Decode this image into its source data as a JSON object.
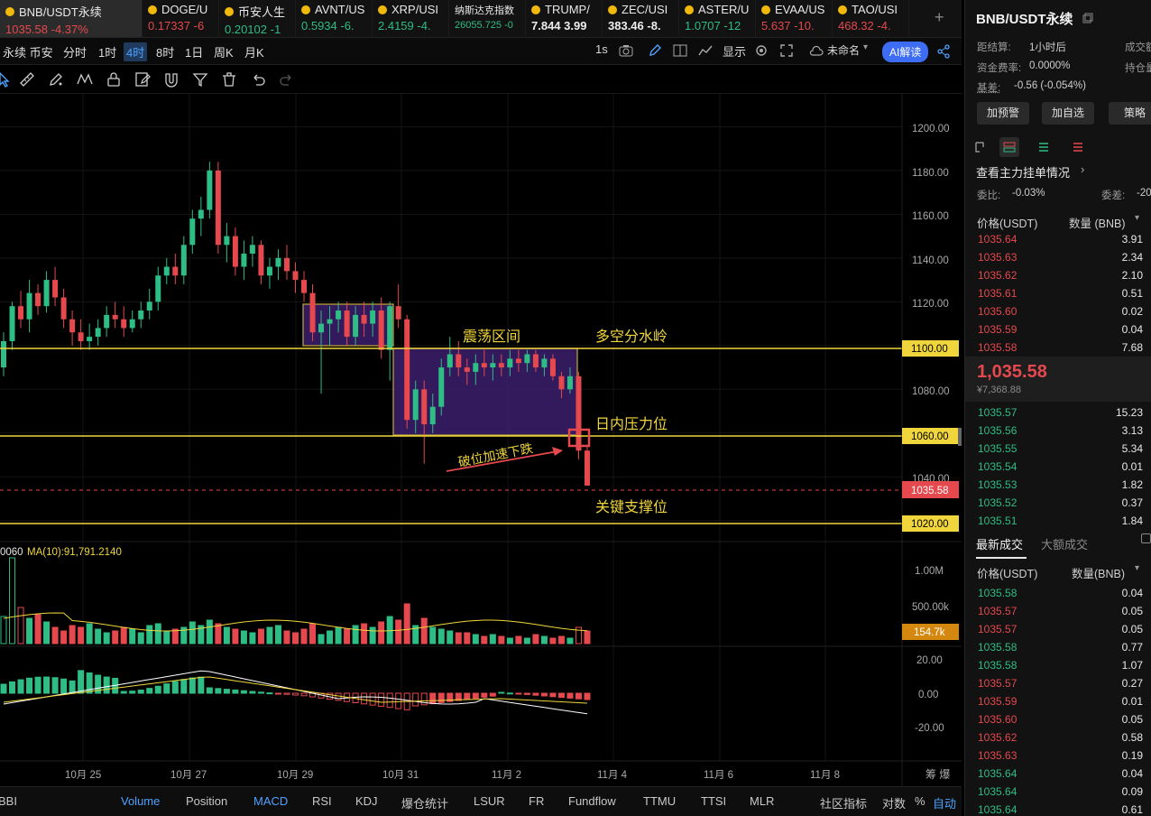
{
  "tickers": [
    {
      "name": "BNB/USDT永续",
      "price": "1035.58",
      "change": "-4.37%",
      "dir": "red",
      "active": true
    },
    {
      "name": "DOGE/U",
      "price": "0.17337",
      "change": "-6",
      "dir": "red"
    },
    {
      "name": "币安人生",
      "price": "0.20102",
      "change": "-1",
      "dir": "green"
    },
    {
      "name": "AVNT/US",
      "price": "0.5934",
      "change": "-6.",
      "dir": "green"
    },
    {
      "name": "XRP/USI",
      "price": "2.4159",
      "change": "-4.",
      "dir": "green"
    },
    {
      "name": "纳斯达克指数",
      "price": "26055.725",
      "change": "-0",
      "dir": "green",
      "small": true
    },
    {
      "name": "TRUMP/",
      "price": "7.844",
      "change": "3.99",
      "dir": "white"
    },
    {
      "name": "ZEC/USI",
      "price": "383.46",
      "change": "-8.",
      "dir": "white"
    },
    {
      "name": "ASTER/U",
      "price": "1.0707",
      "change": "-12",
      "dir": "green"
    },
    {
      "name": "EVAA/US",
      "price": "5.637",
      "change": "-10.",
      "dir": "red"
    },
    {
      "name": "TAO/USI",
      "price": "468.32",
      "change": "-4.",
      "dir": "red"
    }
  ],
  "toolbar": {
    "symbol_label": "永续 币安",
    "intervals": [
      "分时",
      "1时",
      "4时",
      "8时",
      "1日",
      "周K",
      "月K"
    ],
    "selected_interval": "4时",
    "one_sec": "1s",
    "display": "显示",
    "layout_name": "未命名",
    "ai_label": "AI解读"
  },
  "chart": {
    "y_ticks": [
      "1200.00",
      "1180.00",
      "1160.00",
      "1140.00",
      "1120.00",
      "1080.00",
      "1040.00"
    ],
    "x_ticks": [
      "10月 25",
      "10月 27",
      "10月 29",
      "10月 31",
      "11月 2",
      "11月 4",
      "11月 6",
      "11月 8"
    ],
    "levels": {
      "l1100": "1100.00",
      "l1060": "1060.00",
      "l1020": "1020.00",
      "last": "1035.58"
    },
    "annotations": {
      "range": "震荡区间",
      "divide": "多空分水岭",
      "resist": "日内压力位",
      "support": "关键支撑位",
      "breakdown": "破位加速下跌"
    },
    "volume": {
      "ma_label": "MA(10):91,791.2140",
      "left_label": "0060",
      "ticks": [
        "1.00M",
        "500.00k"
      ],
      "current": "154.7k"
    },
    "macd_ticks": [
      "20.00",
      "0.00",
      "-20.00"
    ],
    "right_corner": "筹 爆"
  },
  "chart_data": {
    "type": "candlestick",
    "interval": "4时",
    "series_ohlc": [
      [
        1090,
        1106,
        1086,
        1102
      ],
      [
        1102,
        1120,
        1098,
        1118
      ],
      [
        1118,
        1125,
        1108,
        1112
      ],
      [
        1112,
        1130,
        1106,
        1124
      ],
      [
        1124,
        1128,
        1114,
        1118
      ],
      [
        1118,
        1134,
        1115,
        1130
      ],
      [
        1130,
        1136,
        1118,
        1122
      ],
      [
        1122,
        1126,
        1108,
        1112
      ],
      [
        1112,
        1116,
        1100,
        1106
      ],
      [
        1106,
        1112,
        1098,
        1102
      ],
      [
        1102,
        1110,
        1098,
        1104
      ],
      [
        1104,
        1112,
        1100,
        1108
      ],
      [
        1108,
        1118,
        1104,
        1114
      ],
      [
        1114,
        1120,
        1108,
        1112
      ],
      [
        1112,
        1118,
        1104,
        1108
      ],
      [
        1108,
        1116,
        1106,
        1112
      ],
      [
        1112,
        1120,
        1108,
        1116
      ],
      [
        1116,
        1126,
        1112,
        1120
      ],
      [
        1120,
        1136,
        1116,
        1132
      ],
      [
        1132,
        1140,
        1128,
        1136
      ],
      [
        1136,
        1142,
        1128,
        1132
      ],
      [
        1132,
        1150,
        1128,
        1146
      ],
      [
        1146,
        1162,
        1142,
        1158
      ],
      [
        1158,
        1168,
        1150,
        1162
      ],
      [
        1162,
        1184,
        1158,
        1180
      ],
      [
        1180,
        1184,
        1142,
        1146
      ],
      [
        1146,
        1156,
        1138,
        1150
      ],
      [
        1150,
        1154,
        1132,
        1136
      ],
      [
        1136,
        1148,
        1130,
        1142
      ],
      [
        1142,
        1150,
        1136,
        1146
      ],
      [
        1146,
        1148,
        1128,
        1132
      ],
      [
        1132,
        1140,
        1126,
        1136
      ],
      [
        1136,
        1144,
        1130,
        1140
      ],
      [
        1140,
        1146,
        1130,
        1134
      ],
      [
        1134,
        1138,
        1124,
        1130
      ],
      [
        1130,
        1134,
        1120,
        1124
      ],
      [
        1124,
        1128,
        1102,
        1106
      ],
      [
        1106,
        1116,
        1078,
        1110
      ],
      [
        1110,
        1118,
        1100,
        1112
      ],
      [
        1112,
        1120,
        1106,
        1116
      ],
      [
        1116,
        1120,
        1100,
        1104
      ],
      [
        1104,
        1118,
        1100,
        1114
      ],
      [
        1114,
        1120,
        1104,
        1110
      ],
      [
        1110,
        1120,
        1104,
        1116
      ],
      [
        1116,
        1122,
        1094,
        1098
      ],
      [
        1098,
        1120,
        1084,
        1118
      ],
      [
        1118,
        1128,
        1108,
        1112
      ],
      [
        1112,
        1114,
        1062,
        1066
      ],
      [
        1066,
        1084,
        1060,
        1080
      ],
      [
        1080,
        1084,
        1046,
        1064
      ],
      [
        1064,
        1078,
        1060,
        1072
      ],
      [
        1072,
        1094,
        1068,
        1090
      ],
      [
        1090,
        1104,
        1086,
        1096
      ],
      [
        1096,
        1102,
        1086,
        1090
      ],
      [
        1090,
        1094,
        1082,
        1088
      ],
      [
        1088,
        1096,
        1082,
        1092
      ],
      [
        1092,
        1098,
        1086,
        1090
      ],
      [
        1090,
        1096,
        1084,
        1092
      ],
      [
        1092,
        1096,
        1086,
        1090
      ],
      [
        1090,
        1098,
        1086,
        1094
      ],
      [
        1094,
        1098,
        1088,
        1092
      ],
      [
        1092,
        1098,
        1088,
        1096
      ],
      [
        1096,
        1098,
        1088,
        1090
      ],
      [
        1090,
        1096,
        1086,
        1094
      ],
      [
        1094,
        1096,
        1084,
        1086
      ],
      [
        1086,
        1088,
        1076,
        1080
      ],
      [
        1080,
        1090,
        1078,
        1086
      ],
      [
        1086,
        1088,
        1048,
        1052
      ],
      [
        1052,
        1054,
        1038,
        1036
      ]
    ],
    "y_range": [
      1010,
      1215
    ],
    "horizontal_levels": [
      1100,
      1060,
      1020
    ],
    "last_price": 1035.58
  },
  "indicators": [
    "BBI",
    "Volume",
    "Position",
    "MACD",
    "RSI",
    "KDJ",
    "爆仓统计",
    "LSUR",
    "FR",
    "Fundflow",
    "TTMU",
    "TTSI",
    "MLR",
    "社区指标",
    "对数",
    "%",
    "自动"
  ],
  "panel": {
    "title": "BNB/USDT永续",
    "settle_label": "距结算:",
    "settle_value": "1小时后",
    "turnover_label": "成交额",
    "funding_label": "资金费率:",
    "funding_value": "0.0000%",
    "position_label": "持仓量",
    "basis_label": "基差:",
    "basis_value": "-0.56 (-0.054%)",
    "buttons": [
      "加预警",
      "加自选",
      "策略"
    ],
    "depth_link": "查看主力挂单情况",
    "ratio_label": "委比:",
    "ratio_value": "-0.03%",
    "diff_label": "委差:",
    "diff_value": "-20",
    "ob_price_head": "价格(USDT)",
    "ob_qty_head": "数量 (BNB)",
    "asks": [
      [
        "1035.64",
        "3.91"
      ],
      [
        "1035.63",
        "2.34"
      ],
      [
        "1035.62",
        "2.10"
      ],
      [
        "1035.61",
        "0.51"
      ],
      [
        "1035.60",
        "0.02"
      ],
      [
        "1035.59",
        "0.04"
      ],
      [
        "1035.58",
        "7.68"
      ]
    ],
    "last_price": "1,035.58",
    "last_price_sub": "¥7,368.88",
    "bids": [
      [
        "1035.57",
        "15.23"
      ],
      [
        "1035.56",
        "3.13"
      ],
      [
        "1035.55",
        "5.34"
      ],
      [
        "1035.54",
        "0.01"
      ],
      [
        "1035.53",
        "1.82"
      ],
      [
        "1035.52",
        "0.37"
      ],
      [
        "1035.51",
        "1.84"
      ]
    ],
    "trades_tab": "最新成交",
    "big_trades_tab": "大额成交",
    "trade_price_head": "价格(USDT)",
    "trade_qty_head": "数量(BNB)",
    "trades": [
      [
        "1035.58",
        "0.04",
        "green"
      ],
      [
        "1035.57",
        "0.05",
        "red"
      ],
      [
        "1035.57",
        "0.05",
        "red"
      ],
      [
        "1035.58",
        "0.77",
        "green"
      ],
      [
        "1035.58",
        "1.07",
        "green"
      ],
      [
        "1035.57",
        "0.27",
        "red"
      ],
      [
        "1035.59",
        "0.01",
        "red"
      ],
      [
        "1035.60",
        "0.05",
        "red"
      ],
      [
        "1035.62",
        "0.58",
        "red"
      ],
      [
        "1035.63",
        "0.19",
        "red"
      ],
      [
        "1035.64",
        "0.04",
        "green"
      ],
      [
        "1035.64",
        "0.09",
        "green"
      ],
      [
        "1035.64",
        "0.61",
        "green"
      ]
    ]
  }
}
